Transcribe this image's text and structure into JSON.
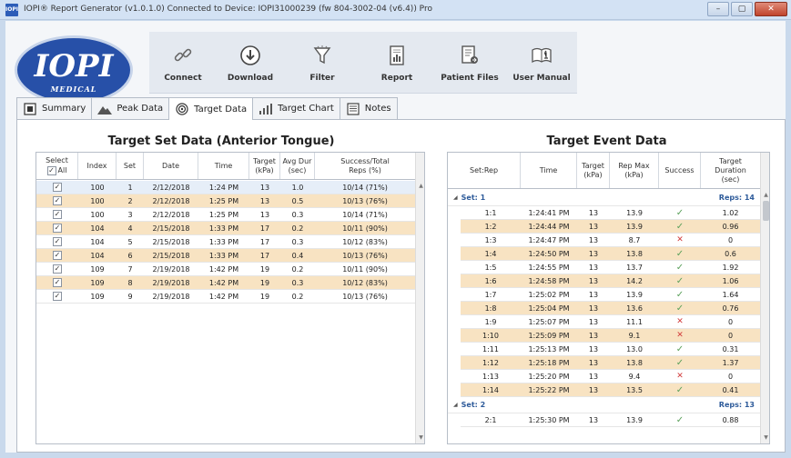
{
  "window": {
    "title": "IOPI® Report Generator  (v1.0.1.0)   Connected to Device: IOPI31000239 (fw 804-3002-04 (v6.4))   Pro",
    "app_icon_text": "IOPI",
    "minimize": "–",
    "maximize": "▢",
    "close": "✕"
  },
  "logo": {
    "text": "IOPI",
    "subtext": "MEDICAL"
  },
  "toolbar": [
    {
      "label": "Connect",
      "icon": "link-icon"
    },
    {
      "label": "Download",
      "icon": "download-icon"
    },
    {
      "label": "Filter",
      "icon": "funnel-icon"
    },
    {
      "label": "Report",
      "icon": "report-icon"
    },
    {
      "label": "Patient Files",
      "icon": "patient-files-icon"
    },
    {
      "label": "User Manual",
      "icon": "book-icon"
    }
  ],
  "tabs": [
    {
      "label": "Summary",
      "icon": "summary-icon",
      "active": false
    },
    {
      "label": "Peak Data",
      "icon": "mountain-icon",
      "active": false
    },
    {
      "label": "Target Data",
      "icon": "target-icon",
      "active": true
    },
    {
      "label": "Target Chart",
      "icon": "bar-chart-icon",
      "active": false
    },
    {
      "label": "Notes",
      "icon": "notes-icon",
      "active": false
    }
  ],
  "set_panel": {
    "title": "Target Set Data (Anterior Tongue)",
    "headers": {
      "select": "Select",
      "all": "All",
      "index": "Index",
      "set": "Set",
      "date": "Date",
      "time": "Time",
      "target": "Target\n(kPa)",
      "avg": "Avg Dur\n(sec)",
      "success": "Success/Total\nReps (%)"
    },
    "rows": [
      {
        "index": "100",
        "set": "1",
        "date": "2/12/2018",
        "time": "1:24 PM",
        "target": "13",
        "avg": "1.0",
        "success": "10/14 (71%)"
      },
      {
        "index": "100",
        "set": "2",
        "date": "2/12/2018",
        "time": "1:25 PM",
        "target": "13",
        "avg": "0.5",
        "success": "10/13 (76%)"
      },
      {
        "index": "100",
        "set": "3",
        "date": "2/12/2018",
        "time": "1:25 PM",
        "target": "13",
        "avg": "0.3",
        "success": "10/14 (71%)"
      },
      {
        "index": "104",
        "set": "4",
        "date": "2/15/2018",
        "time": "1:33 PM",
        "target": "17",
        "avg": "0.2",
        "success": "10/11 (90%)"
      },
      {
        "index": "104",
        "set": "5",
        "date": "2/15/2018",
        "time": "1:33 PM",
        "target": "17",
        "avg": "0.3",
        "success": "10/12 (83%)"
      },
      {
        "index": "104",
        "set": "6",
        "date": "2/15/2018",
        "time": "1:33 PM",
        "target": "17",
        "avg": "0.4",
        "success": "10/13 (76%)"
      },
      {
        "index": "109",
        "set": "7",
        "date": "2/19/2018",
        "time": "1:42 PM",
        "target": "19",
        "avg": "0.2",
        "success": "10/11 (90%)"
      },
      {
        "index": "109",
        "set": "8",
        "date": "2/19/2018",
        "time": "1:42 PM",
        "target": "19",
        "avg": "0.3",
        "success": "10/12 (83%)"
      },
      {
        "index": "109",
        "set": "9",
        "date": "2/19/2018",
        "time": "1:42 PM",
        "target": "19",
        "avg": "0.2",
        "success": "10/13 (76%)"
      }
    ]
  },
  "event_panel": {
    "title": "Target Event Data",
    "headers": {
      "setrep": "Set:Rep",
      "time": "Time",
      "target": "Target\n(kPa)",
      "repmax": "Rep Max\n(kPa)",
      "success": "Success",
      "duration": "Target\nDuration\n(sec)"
    },
    "groups": [
      {
        "label": "Set: 1",
        "reps": "Reps: 14",
        "rows": [
          {
            "setrep": "1:1",
            "time": "1:24:41 PM",
            "target": "13",
            "repmax": "13.9",
            "success": true,
            "duration": "1.02"
          },
          {
            "setrep": "1:2",
            "time": "1:24:44 PM",
            "target": "13",
            "repmax": "13.9",
            "success": true,
            "duration": "0.96"
          },
          {
            "setrep": "1:3",
            "time": "1:24:47 PM",
            "target": "13",
            "repmax": "8.7",
            "success": false,
            "duration": "0"
          },
          {
            "setrep": "1:4",
            "time": "1:24:50 PM",
            "target": "13",
            "repmax": "13.8",
            "success": true,
            "duration": "0.6"
          },
          {
            "setrep": "1:5",
            "time": "1:24:55 PM",
            "target": "13",
            "repmax": "13.7",
            "success": true,
            "duration": "1.92"
          },
          {
            "setrep": "1:6",
            "time": "1:24:58 PM",
            "target": "13",
            "repmax": "14.2",
            "success": true,
            "duration": "1.06"
          },
          {
            "setrep": "1:7",
            "time": "1:25:02 PM",
            "target": "13",
            "repmax": "13.9",
            "success": true,
            "duration": "1.64"
          },
          {
            "setrep": "1:8",
            "time": "1:25:04 PM",
            "target": "13",
            "repmax": "13.6",
            "success": true,
            "duration": "0.76"
          },
          {
            "setrep": "1:9",
            "time": "1:25:07 PM",
            "target": "13",
            "repmax": "11.1",
            "success": false,
            "duration": "0"
          },
          {
            "setrep": "1:10",
            "time": "1:25:09 PM",
            "target": "13",
            "repmax": "9.1",
            "success": false,
            "duration": "0"
          },
          {
            "setrep": "1:11",
            "time": "1:25:13 PM",
            "target": "13",
            "repmax": "13.0",
            "success": true,
            "duration": "0.31"
          },
          {
            "setrep": "1:12",
            "time": "1:25:18 PM",
            "target": "13",
            "repmax": "13.8",
            "success": true,
            "duration": "1.37"
          },
          {
            "setrep": "1:13",
            "time": "1:25:20 PM",
            "target": "13",
            "repmax": "9.4",
            "success": false,
            "duration": "0"
          },
          {
            "setrep": "1:14",
            "time": "1:25:22 PM",
            "target": "13",
            "repmax": "13.5",
            "success": true,
            "duration": "0.41"
          }
        ]
      },
      {
        "label": "Set: 2",
        "reps": "Reps: 13",
        "rows": [
          {
            "setrep": "2:1",
            "time": "1:25:30 PM",
            "target": "13",
            "repmax": "13.9",
            "success": true,
            "duration": "0.88"
          }
        ]
      }
    ]
  },
  "colors": {
    "row_alt": "#f8e3c2",
    "row_selected": "#e6eef8",
    "success_check": "#5aa05a",
    "fail_x": "#d23c3c",
    "group_text": "#2e5b9a"
  },
  "glyphs": {
    "check": "✓",
    "cross": "✕",
    "tri_down": "◢"
  }
}
